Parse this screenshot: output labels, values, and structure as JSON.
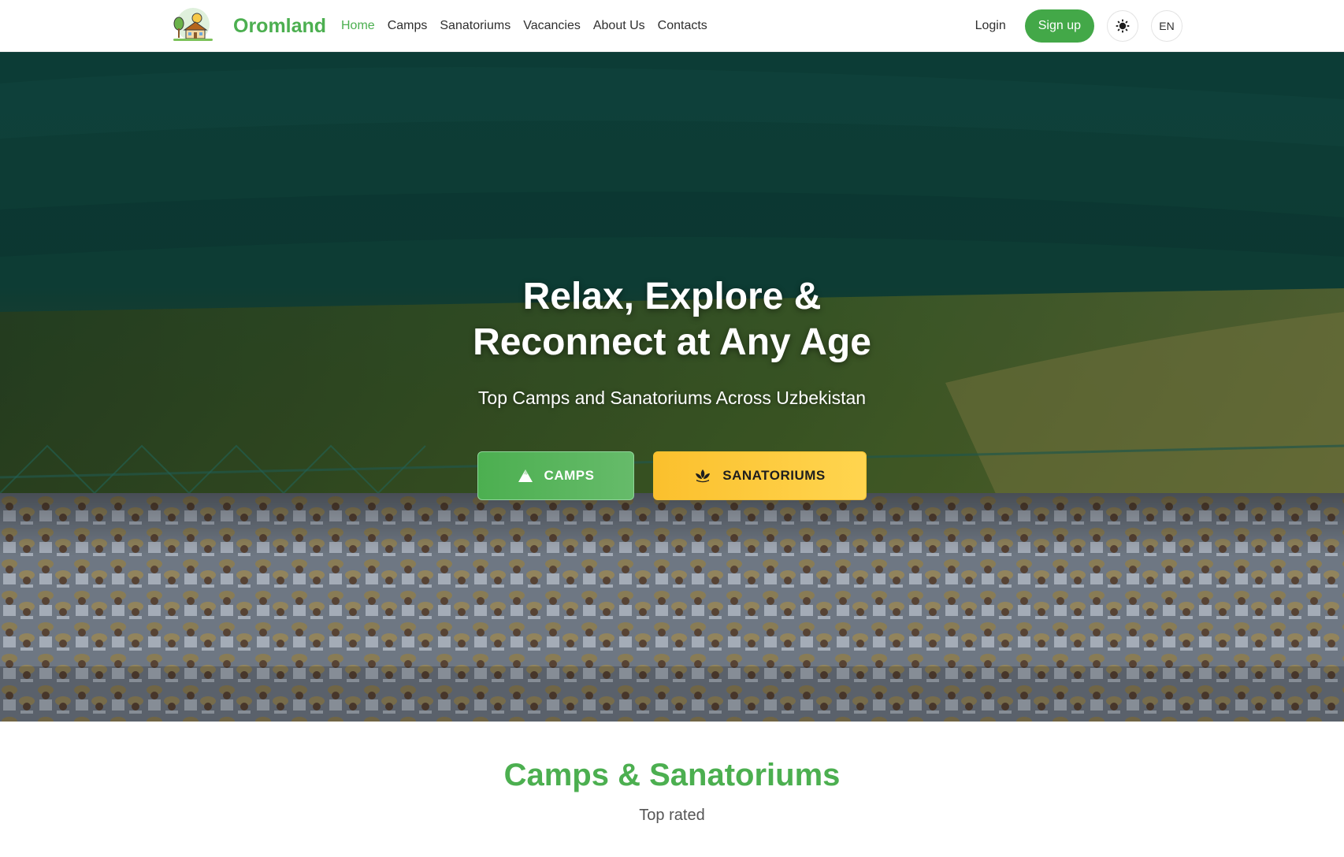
{
  "brand": {
    "name": "Oromland",
    "logo_icon": "camp-house-logo"
  },
  "nav": {
    "links": [
      "Home",
      "Camps",
      "Sanatoriums",
      "Vacancies",
      "About Us",
      "Contacts"
    ],
    "active": "Home"
  },
  "auth": {
    "login": "Login",
    "signup": "Sign up"
  },
  "controls": {
    "theme_icon": "sun-icon",
    "language": "EN"
  },
  "hero": {
    "title_line1": "Relax, Explore &",
    "title_line2": "Reconnect at Any Age",
    "subtitle": "Top Camps and Sanatoriums Across Uzbekistan",
    "buttons": {
      "camps": {
        "label": "CAMPS",
        "icon": "mountain-icon"
      },
      "sanatoriums": {
        "label": "SANATORIUMS",
        "icon": "lotus-icon"
      }
    }
  },
  "section": {
    "title": "Camps & Sanatoriums",
    "subtitle": "Top rated"
  },
  "colors": {
    "accent": "#4caf50",
    "signup": "#43a848",
    "sanatorium_button": "#fbc02d"
  }
}
